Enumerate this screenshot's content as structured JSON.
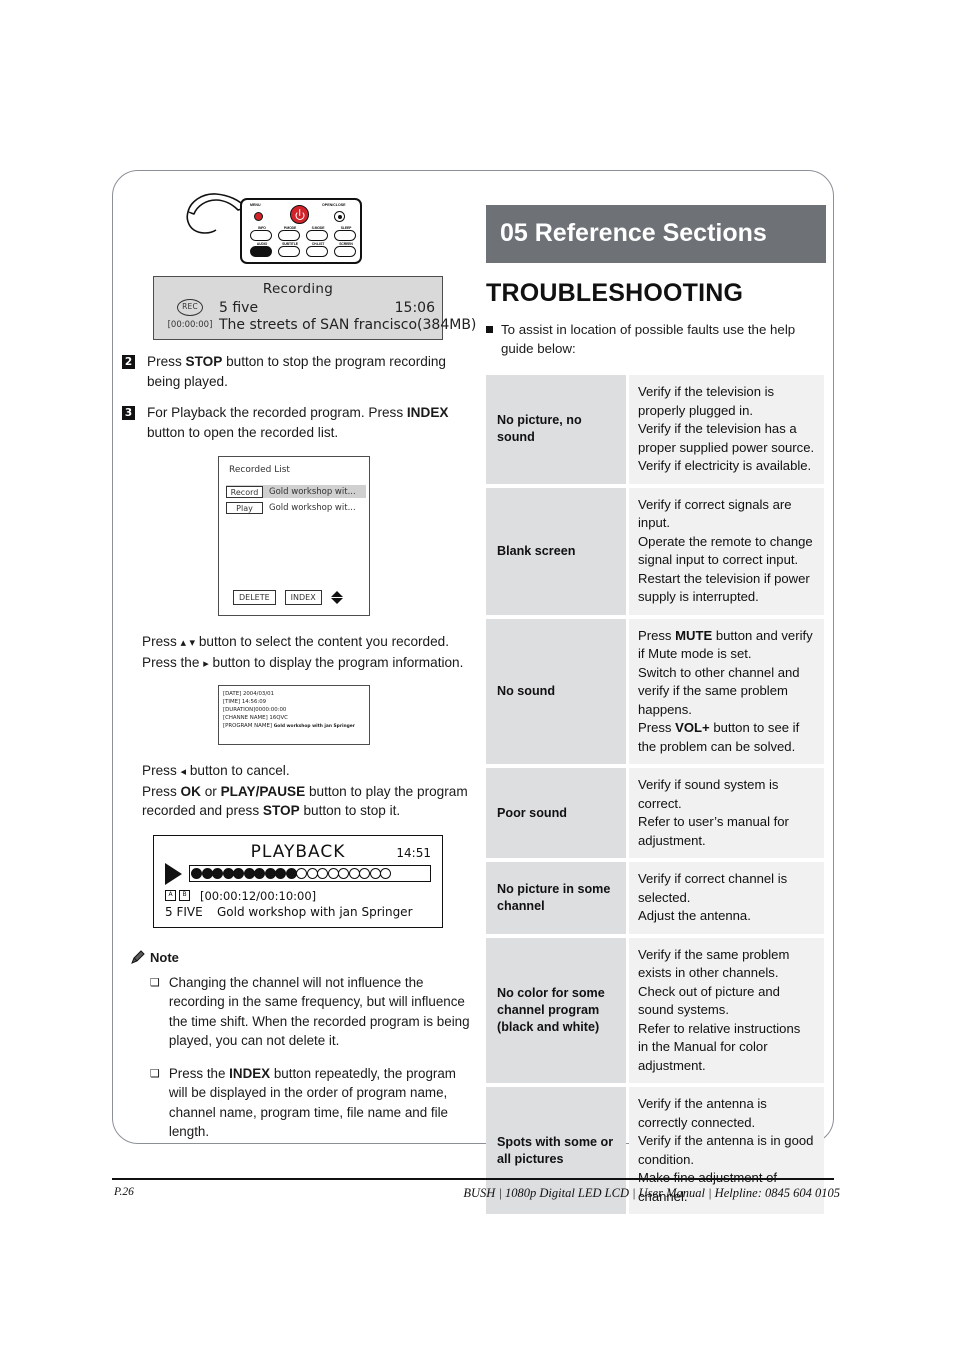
{
  "page": {
    "number_label": "P.26",
    "footer_right": "BUSH  | 1080p  Digital LED LCD | User Manual | Helpline: 0845 604 0105"
  },
  "colors": {
    "banner_bg": "#6e7277",
    "table_key_bg": "#dcdee0",
    "table_val_bg": "#f1f1f1",
    "osd_gray": "#d9d9d9",
    "remote_power_red": "#d2232a",
    "frame_border": "#8b8f96"
  },
  "remote": {
    "labels_top": {
      "menu": "MENU",
      "open_close": "OPEN/CLOSE"
    },
    "row1": [
      "INFO",
      "P.MODE",
      "S.MODE",
      "SLEEP"
    ],
    "row2": [
      "AUDIO",
      "SUBTITLE",
      "CH.LIST",
      "SCREEN"
    ]
  },
  "osd_recording": {
    "title": "Recording",
    "rec_badge": "REC",
    "timecode": "[00:00:00]",
    "channel": "5 five",
    "clock": "15:06",
    "program": "The streets of SAN francisco(384MB)"
  },
  "steps": [
    {
      "number": "2",
      "parts": [
        {
          "t": "Press "
        },
        {
          "t": "STOP",
          "b": true
        },
        {
          "t": " button to stop the program recording being played."
        }
      ]
    },
    {
      "number": "3",
      "parts": [
        {
          "t": "For Playback the recorded program. Press "
        },
        {
          "t": "INDEX",
          "b": true
        },
        {
          "t": " button to open the recorded list."
        }
      ]
    }
  ],
  "osd_recorded_list": {
    "title": "Recorded List",
    "rows": [
      {
        "tag": "Record",
        "name": "Gold workshop wit..."
      },
      {
        "tag": "Play",
        "name": "Gold workshop wit..."
      }
    ],
    "buttons": [
      "DELETE",
      "INDEX"
    ],
    "nav_icon": "up-down-diamond-icon"
  },
  "press_select": {
    "line1_a": "Press",
    "arrows_updown": "▴ ▾",
    "line1_b": "button to select the content you recorded.",
    "line2_a": "Press the",
    "arrow_right": "▸",
    "line2_b": "button to display the program information."
  },
  "osd_program_info": {
    "date": "[DATE] 2004/03/01",
    "time": "[TIME] 14:56:09",
    "duration": "[DURATION]0000:00:00",
    "channel_name": "[CHANNE NAME] 16QVC",
    "program_name_label": "[PROGRAM NAME]",
    "program_name_value": "Gold workshop with jan Springer"
  },
  "press_play": {
    "line1_a": "Press",
    "arrow_left": "◂",
    "line1_b": "button to cancel.",
    "parts2": [
      {
        "t": "Press "
      },
      {
        "t": "OK",
        "b": true
      },
      {
        "t": " or "
      },
      {
        "t": "PLAY/PAUSE",
        "b": true
      },
      {
        "t": " button to play the program recorded and press "
      },
      {
        "t": "STOP",
        "b": true
      },
      {
        "t": " button to stop it."
      }
    ]
  },
  "osd_playback": {
    "title": "PLAYBACK",
    "clock": "14:51",
    "play_icon": "play-triangle-icon",
    "dots_filled": 10,
    "dots_empty": 9,
    "repeat_a": "A",
    "repeat_b": "B",
    "timecode": "[00:00:12/00:10:00]",
    "channel": "5 FIVE",
    "program": "Gold workshop with jan Springer"
  },
  "note": {
    "icon": "pencil-icon",
    "heading": "Note",
    "items": [
      {
        "parts": [
          {
            "t": "Changing the channel will not influence the recording in the same frequency, but will influence the time shift. When the recorded program is being played, you can not delete it."
          }
        ]
      },
      {
        "parts": [
          {
            "t": "Press the "
          },
          {
            "t": "INDEX",
            "b": true
          },
          {
            "t": " button repeatedly, the program will be displayed in the order of program name, channel name, program time, file name and file length."
          }
        ]
      }
    ]
  },
  "reference": {
    "banner": "05 Reference Sections",
    "title": "TROUBLESHOOTING",
    "intro": "To assist in location of possible faults use the help guide below:"
  },
  "troubleshooting": {
    "rows": [
      {
        "symptom": "No picture, no sound",
        "remedy_parts": [
          {
            "t": "Verify if the television is properly plugged in.\nVerify if the television has a proper supplied power source.\nVerify if electricity is available."
          }
        ]
      },
      {
        "symptom": "Blank screen",
        "remedy_parts": [
          {
            "t": "Verify if correct signals are input.\nOperate the remote to change signal input to correct input.\nRestart the television if power supply is interrupted."
          }
        ]
      },
      {
        "symptom": "No sound",
        "remedy_parts": [
          {
            "t": "Press "
          },
          {
            "t": "MUTE",
            "b": true
          },
          {
            "t": " button and verify if Mute mode is set.\nSwitch to other channel and verify if the same problem happens.\nPress "
          },
          {
            "t": "VOL+",
            "b": true
          },
          {
            "t": " button to see if the problem can be solved."
          }
        ]
      },
      {
        "symptom": "Poor sound",
        "remedy_parts": [
          {
            "t": "Verify if sound system is correct.\nRefer to user’s manual for adjustment."
          }
        ]
      },
      {
        "symptom": "No picture in some channel",
        "remedy_parts": [
          {
            "t": "Verify if correct channel is selected.\nAdjust the antenna."
          }
        ]
      },
      {
        "symptom": "No color for some channel program (black and white)",
        "remedy_parts": [
          {
            "t": "Verify if the same problem exists in other channels.\nCheck out of picture and sound systems.\nRefer to relative instructions\nin the Manual for color adjustment."
          }
        ]
      },
      {
        "symptom": "Spots with some or all pictures",
        "remedy_parts": [
          {
            "t": "Verify if the antenna is correctly connected.\nVerify if the antenna is in good condition.\nMake fine adjustment of channel."
          }
        ]
      }
    ]
  }
}
